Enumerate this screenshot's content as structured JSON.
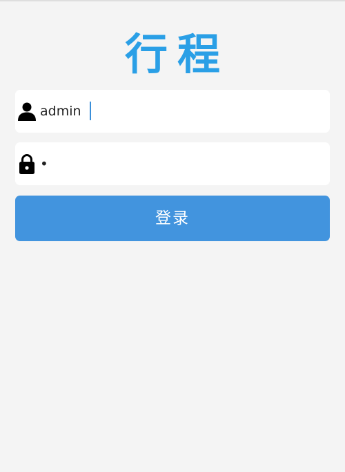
{
  "app": {
    "logo_text": "行程"
  },
  "login_form": {
    "username": {
      "value": "admin",
      "icon": "user-icon"
    },
    "password": {
      "value": "•",
      "icon": "lock-icon"
    },
    "submit_label": "登录"
  },
  "colors": {
    "logo": "#2a9fe6",
    "button": "#4294de",
    "background": "#f4f4f4",
    "field_background": "#ffffff",
    "caret": "#3a8fd9"
  }
}
